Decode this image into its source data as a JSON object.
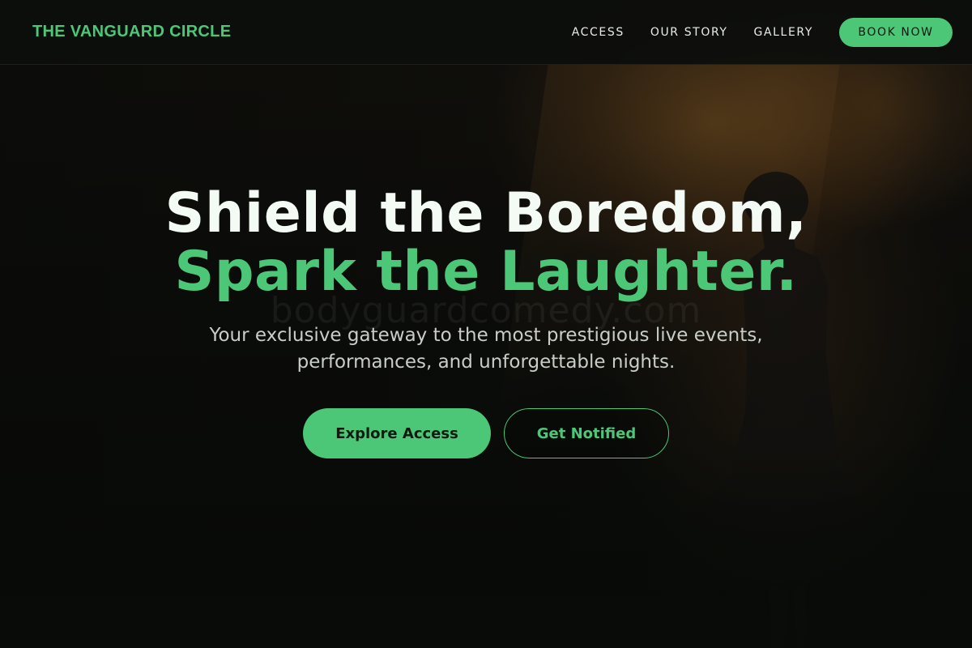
{
  "header": {
    "brand": "THE VANGUARD CIRCLE",
    "nav": [
      {
        "label": "ACCESS"
      },
      {
        "label": "OUR STORY"
      },
      {
        "label": "GALLERY"
      }
    ],
    "book_label": "BOOK NOW"
  },
  "hero": {
    "title_line1": "Shield the Boredom,",
    "title_line2": "Spark the Laughter.",
    "subtitle_line1": "Your exclusive gateway to the most prestigious live events,",
    "subtitle_line2": "performances, and unforgettable nights.",
    "primary_cta": "Explore Access",
    "secondary_cta": "Get Notified"
  },
  "watermark": "bodyguardcomedy.com",
  "colors": {
    "accent": "#4cc777",
    "background": "#090c09",
    "heading": "#f4fbf4",
    "subtext": "#c9cdc8"
  }
}
